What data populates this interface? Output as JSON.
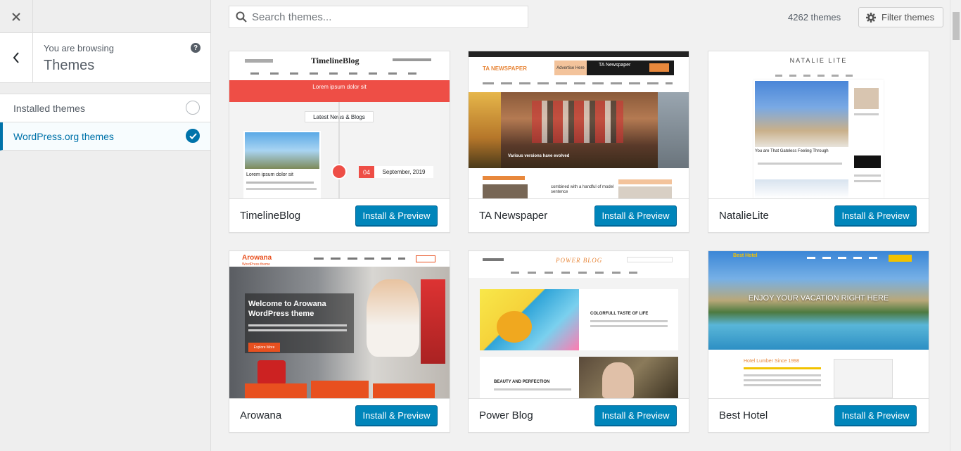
{
  "sidebar": {
    "browsing_label": "You are browsing",
    "browsing_title": "Themes",
    "filters": [
      {
        "label": "Installed themes"
      },
      {
        "label": "WordPress.org themes"
      }
    ]
  },
  "search": {
    "placeholder": "Search themes..."
  },
  "theme_count": "4262 themes",
  "filter_button": "Filter themes",
  "install_label": "Install & Preview",
  "themes": [
    {
      "name": "TimelineBlog",
      "logo": "TimelineBlog",
      "hero": "Lorem ipsum dolor sit",
      "badge": "Latest News & Blogs",
      "post_title": "Lorem ipsum dolor sit",
      "date_day": "04",
      "date_text": "September, 2019"
    },
    {
      "name": "TA Newspaper",
      "logo": "TA NEWSPAPER",
      "ad_top": "Advertise Here",
      "ad_title": "TA Newspaper",
      "caption": "Various versions have evolved",
      "side_text": "combined with a handful of model sentence"
    },
    {
      "name": "NatalieLite",
      "logo": "NATALIE LITE",
      "post_title": "You are That Gateless Feeling Through"
    },
    {
      "name": "Arowana",
      "logo": "Arowana",
      "logo_sub": "WordPress theme",
      "hero": "Welcome to Arowana WordPress theme",
      "cta": "Explore More"
    },
    {
      "name": "Power Blog",
      "logo": "POWER BLOG",
      "post1": "COLORFULL TASTE OF LIFE",
      "post2": "BEAUTY AND PERFECTION"
    },
    {
      "name": "Best Hotel",
      "logo": "Best Hotel",
      "hero": "ENJOY YOUR VACATION RIGHT HERE",
      "sub": "Hotel Lumber Since 1998"
    }
  ],
  "colors": {
    "accent": "#0073aa",
    "button": "#0085ba"
  }
}
